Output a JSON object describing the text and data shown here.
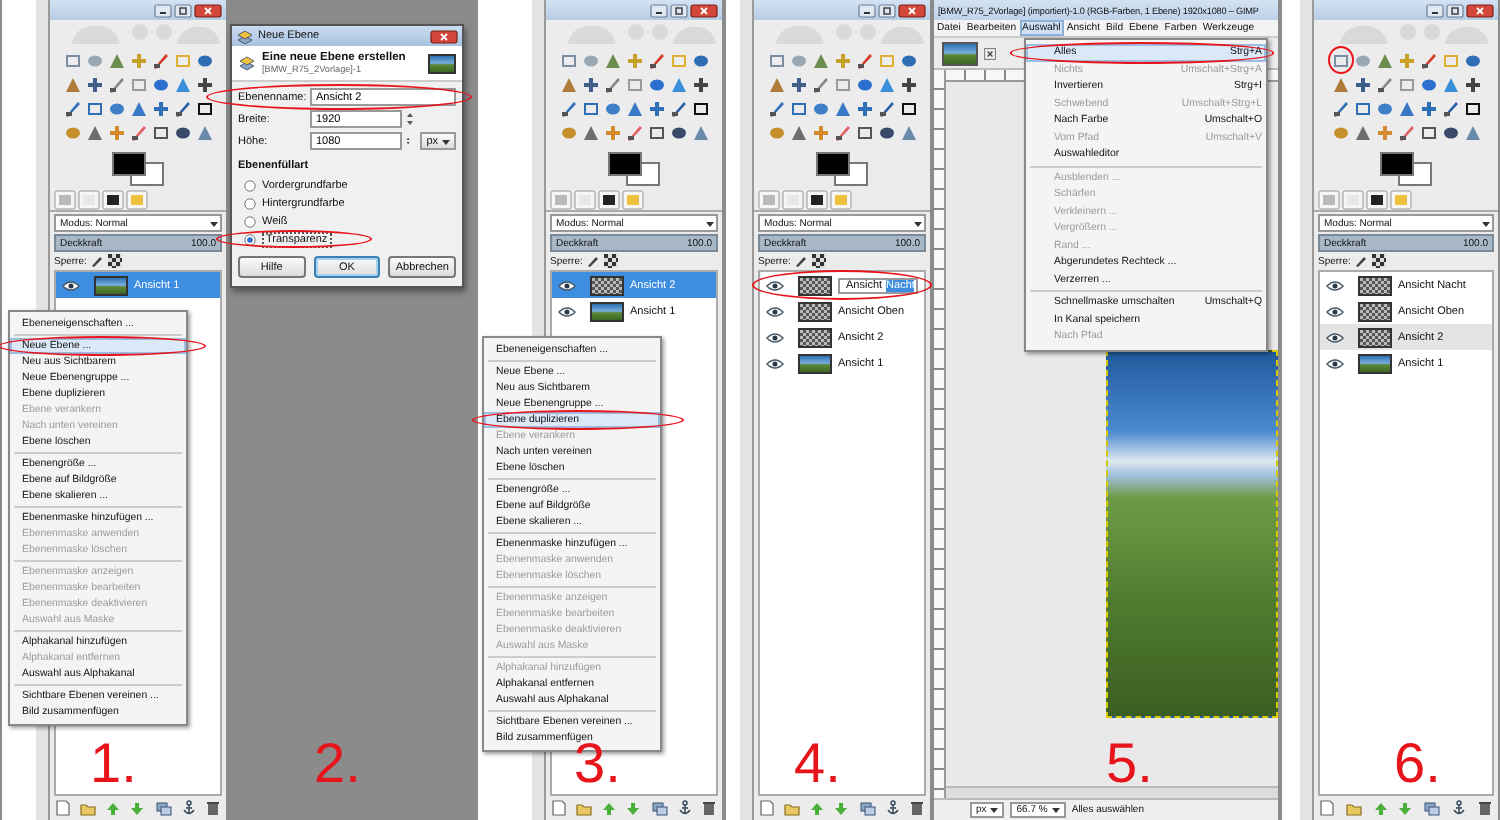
{
  "panels": [
    {
      "kind": "layers",
      "step": "1.",
      "mode": "Modus: Normal",
      "opacity_label": "Deckkraft",
      "opacity_value": "100.0",
      "level": 1,
      "lock_label": "Sperre:",
      "layers": [
        {
          "name": "Ansicht 1",
          "kind": "photo",
          "selected": true,
          "editing": false
        }
      ],
      "context_menu": [
        [
          {
            "label": "Ebeneneigenschaften ...",
            "disabled": false,
            "selected": false
          }
        ],
        [
          {
            "label": "Neue Ebene ...",
            "disabled": false,
            "selected": true,
            "circled": true
          },
          {
            "label": "Neu aus Sichtbarem",
            "disabled": false,
            "selected": false
          },
          {
            "label": "Neue Ebenengruppe ...",
            "disabled": false,
            "selected": false
          },
          {
            "label": "Ebene duplizieren",
            "disabled": false,
            "selected": false
          },
          {
            "label": "Ebene verankern",
            "disabled": true,
            "selected": false
          },
          {
            "label": "Nach unten vereinen",
            "disabled": true,
            "selected": false
          },
          {
            "label": "Ebene löschen",
            "disabled": false,
            "selected": false
          }
        ],
        [
          {
            "label": "Ebenengröße ...",
            "disabled": false,
            "selected": false
          },
          {
            "label": "Ebene auf Bildgröße",
            "disabled": false,
            "selected": false
          },
          {
            "label": "Ebene skalieren ...",
            "disabled": false,
            "selected": false
          }
        ],
        [
          {
            "label": "Ebenenmaske hinzufügen ...",
            "disabled": false,
            "selected": false
          },
          {
            "label": "Ebenenmaske anwenden",
            "disabled": true,
            "selected": false
          },
          {
            "label": "Ebenenmaske löschen",
            "disabled": true,
            "selected": false
          }
        ],
        [
          {
            "label": "Ebenenmaske anzeigen",
            "disabled": true,
            "selected": false
          },
          {
            "label": "Ebenenmaske bearbeiten",
            "disabled": true,
            "selected": false
          },
          {
            "label": "Ebenenmaske deaktivieren",
            "disabled": true,
            "selected": false
          },
          {
            "label": "Auswahl aus Maske",
            "disabled": true,
            "selected": false
          }
        ],
        [
          {
            "label": "Alphakanal hinzufügen",
            "disabled": false,
            "selected": false
          },
          {
            "label": "Alphakanal entfernen",
            "disabled": true,
            "selected": false
          },
          {
            "label": "Auswahl aus Alphakanal",
            "disabled": false,
            "selected": false
          }
        ],
        [
          {
            "label": "Sichtbare Ebenen vereinen ...",
            "disabled": false,
            "selected": false
          },
          {
            "label": "Bild zusammenfügen",
            "disabled": false,
            "selected": false
          }
        ]
      ]
    },
    {
      "kind": "dialog",
      "step": "2.",
      "dialog": {
        "title": "Neue Ebene",
        "heading": "Eine neue Ebene erstellen",
        "image_name": "[BMW_R75_2Vorlage]-1",
        "fields": [
          {
            "label": "Ebenenname:",
            "value": "Ansicht 2",
            "kind": "text",
            "circled": true
          },
          {
            "label": "Breite:",
            "value": "1920",
            "kind": "spin"
          },
          {
            "label": "Höhe:",
            "value": "1080",
            "kind": "spin",
            "unit": "px"
          }
        ],
        "fill_heading": "Ebenenfüllart",
        "fill_options": [
          {
            "label": "Vordergrundfarbe",
            "selected": false
          },
          {
            "label": "Hintergrundfarbe",
            "selected": false
          },
          {
            "label": "Weiß",
            "selected": false
          },
          {
            "label": "Transparenz",
            "selected": true,
            "circled": true
          }
        ],
        "buttons": [
          {
            "label": "Hilfe",
            "kind": "help"
          },
          {
            "label": "OK",
            "kind": "ok"
          },
          {
            "label": "Abbrechen",
            "kind": "cancel"
          }
        ]
      }
    },
    {
      "kind": "layers",
      "step": "3.",
      "mode": "Modus: Normal",
      "opacity_label": "Deckkraft",
      "opacity_value": "100.0",
      "level": 1,
      "lock_label": "Sperre:",
      "layers": [
        {
          "name": "Ansicht 2",
          "kind": "transparent",
          "selected": true,
          "editing": false
        },
        {
          "name": "Ansicht 1",
          "kind": "photo",
          "selected": false,
          "editing": false
        }
      ],
      "context_menu": [
        [
          {
            "label": "Ebeneneigenschaften ...",
            "disabled": false,
            "selected": false
          }
        ],
        [
          {
            "label": "Neue Ebene ...",
            "disabled": false,
            "selected": false
          },
          {
            "label": "Neu aus Sichtbarem",
            "disabled": false,
            "selected": false
          },
          {
            "label": "Neue Ebenengruppe ...",
            "disabled": false,
            "selected": false
          },
          {
            "label": "Ebene duplizieren",
            "disabled": false,
            "selected": true,
            "circled": true
          },
          {
            "label": "Ebene verankern",
            "disabled": true,
            "selected": false
          },
          {
            "label": "Nach unten vereinen",
            "disabled": false,
            "selected": false
          },
          {
            "label": "Ebene löschen",
            "disabled": false,
            "selected": false
          }
        ],
        [
          {
            "label": "Ebenengröße ...",
            "disabled": false,
            "selected": false
          },
          {
            "label": "Ebene auf Bildgröße",
            "disabled": false,
            "selected": false
          },
          {
            "label": "Ebene skalieren ...",
            "disabled": false,
            "selected": false
          }
        ],
        [
          {
            "label": "Ebenenmaske hinzufügen ...",
            "disabled": false,
            "selected": false
          },
          {
            "label": "Ebenenmaske anwenden",
            "disabled": true,
            "selected": false
          },
          {
            "label": "Ebenenmaske löschen",
            "disabled": true,
            "selected": false
          }
        ],
        [
          {
            "label": "Ebenenmaske anzeigen",
            "disabled": true,
            "selected": false
          },
          {
            "label": "Ebenenmaske bearbeiten",
            "disabled": true,
            "selected": false
          },
          {
            "label": "Ebenenmaske deaktivieren",
            "disabled": true,
            "selected": false
          },
          {
            "label": "Auswahl aus Maske",
            "disabled": true,
            "selected": false
          }
        ],
        [
          {
            "label": "Alphakanal hinzufügen",
            "disabled": true,
            "selected": false
          },
          {
            "label": "Alphakanal entfernen",
            "disabled": false,
            "selected": false
          },
          {
            "label": "Auswahl aus Alphakanal",
            "disabled": false,
            "selected": false
          }
        ],
        [
          {
            "label": "Sichtbare Ebenen vereinen ...",
            "disabled": false,
            "selected": false
          },
          {
            "label": "Bild zusammenfügen",
            "disabled": false,
            "selected": false
          }
        ]
      ]
    },
    {
      "kind": "layers",
      "step": "4.",
      "mode": "Modus: Normal",
      "opacity_label": "Deckkraft",
      "opacity_value": "100.0",
      "level": 1,
      "lock_label": "Sperre:",
      "layers": [
        {
          "name": "Ansicht",
          "selected_text": "Nacht",
          "kind": "transparent",
          "selected": false,
          "editing": true,
          "circled": true
        },
        {
          "name": "Ansicht Oben",
          "kind": "transparent",
          "selected": false,
          "editing": false
        },
        {
          "name": "Ansicht 2",
          "kind": "transparent",
          "selected": false,
          "editing": false
        },
        {
          "name": "Ansicht 1",
          "kind": "photo",
          "selected": false,
          "editing": false
        }
      ]
    },
    {
      "kind": "image",
      "step": "5.",
      "title": "[BMW_R75_2Vorlage] (importiert)-1.0 (RGB-Farben, 1 Ebene) 1920x1080 – GIMP",
      "menubar": [
        {
          "label": "Datei",
          "selected": false
        },
        {
          "label": "Bearbeiten",
          "selected": false
        },
        {
          "label": "Auswahl",
          "selected": true
        },
        {
          "label": "Ansicht",
          "selected": false
        },
        {
          "label": "Bild",
          "selected": false
        },
        {
          "label": "Ebene",
          "selected": false
        },
        {
          "label": "Farben",
          "selected": false
        },
        {
          "label": "Werkzeuge",
          "selected": false
        }
      ],
      "menu": [
        [
          {
            "label": "Alles",
            "shortcut": "Strg+A",
            "disabled": false,
            "selected": true,
            "circled": true
          },
          {
            "label": "Nichts",
            "shortcut": "Umschalt+Strg+A",
            "disabled": true,
            "selected": false
          },
          {
            "label": "Invertieren",
            "shortcut": "Strg+I",
            "disabled": false,
            "selected": false
          },
          {
            "label": "Schwebend",
            "shortcut": "Umschalt+Strg+L",
            "disabled": true,
            "selected": false
          },
          {
            "label": "Nach Farbe",
            "shortcut": "Umschalt+O",
            "disabled": false,
            "selected": false
          },
          {
            "label": "Vom Pfad",
            "shortcut": "Umschalt+V",
            "disabled": true,
            "selected": false
          },
          {
            "label": "Auswahleditor",
            "disabled": false,
            "selected": false
          }
        ],
        [
          {
            "label": "Ausblenden ...",
            "disabled": true,
            "selected": false
          },
          {
            "label": "Schärfen",
            "disabled": true,
            "selected": false
          },
          {
            "label": "Verkleinern ...",
            "disabled": true,
            "selected": false
          },
          {
            "label": "Vergrößern ...",
            "disabled": true,
            "selected": false
          },
          {
            "label": "Rand ...",
            "disabled": true,
            "selected": false
          },
          {
            "label": "Abgerundetes Rechteck ...",
            "disabled": false,
            "selected": false
          },
          {
            "label": "Verzerren ...",
            "disabled": false,
            "selected": false
          }
        ],
        [
          {
            "label": "Schnellmaske umschalten",
            "shortcut": "Umschalt+Q",
            "disabled": false,
            "selected": false
          },
          {
            "label": "In Kanal speichern",
            "disabled": false,
            "selected": false
          },
          {
            "label": "Nach Pfad",
            "disabled": true,
            "selected": false
          }
        ]
      ],
      "unit": "px",
      "zoom": "66.7 %",
      "status": "Alles auswählen"
    },
    {
      "kind": "layers",
      "step": "6.",
      "tool_circled": true,
      "mode": "Modus: Normal",
      "opacity_label": "Deckkraft",
      "opacity_value": "100.0",
      "level": 1,
      "lock_label": "Sperre:",
      "layers": [
        {
          "name": "Ansicht Nacht",
          "kind": "transparent",
          "selected": false,
          "editing": false
        },
        {
          "name": "Ansicht Oben",
          "kind": "transparent",
          "selected": false,
          "editing": false
        },
        {
          "name": "Ansicht 2",
          "kind": "transparent",
          "selected": true,
          "editing": false
        },
        {
          "name": "Ansicht 1",
          "kind": "photo",
          "selected": false,
          "editing": false
        }
      ]
    }
  ]
}
